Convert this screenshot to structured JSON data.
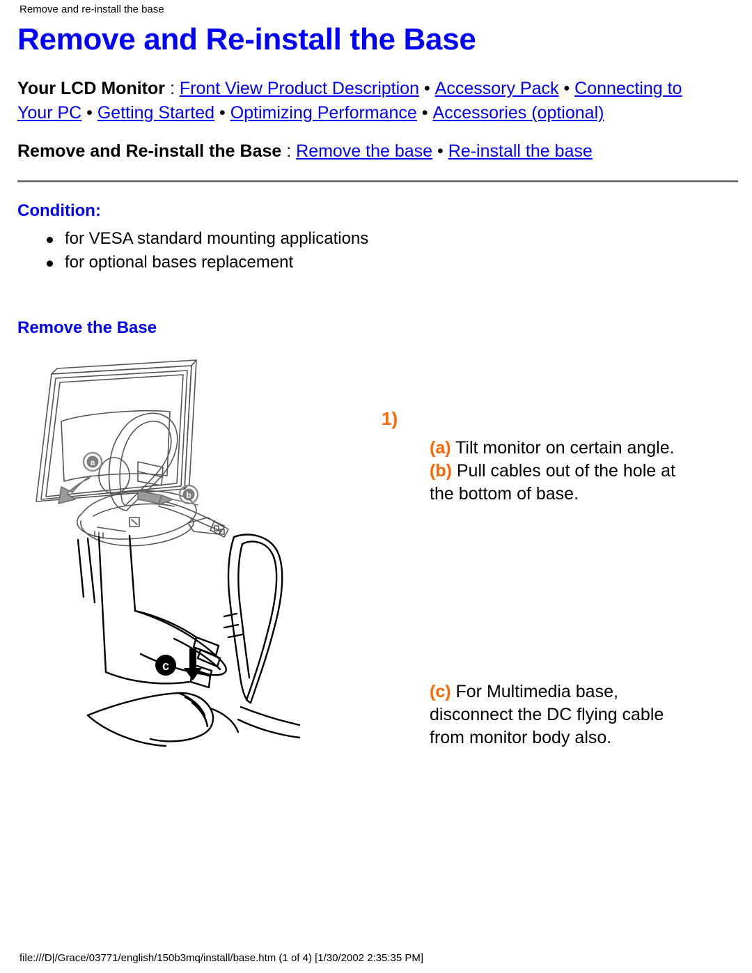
{
  "page_header": "Remove and re-install the base",
  "title": "Remove and Re-install the Base",
  "nav1": {
    "label": "Your LCD Monitor",
    "colon": " : ",
    "links": [
      "Front View Product Description",
      "Accessory Pack",
      "Connecting to Your PC",
      "Getting Started",
      "Optimizing Performance",
      "Accessories (optional)"
    ],
    "separator": "•"
  },
  "nav2": {
    "label": "Remove and Re-install the Base",
    "colon": " : ",
    "links": [
      "Remove the base",
      "Re-install the base"
    ],
    "separator": "•"
  },
  "condition": {
    "heading": "Condition:",
    "items": [
      "for VESA standard mounting applications",
      "for optional bases replacement"
    ]
  },
  "remove_section": {
    "heading": "Remove the Base",
    "step_number": "1)",
    "steps": [
      {
        "mark": "(a)",
        "text": " Tilt monitor on certain angle."
      },
      {
        "mark": "(b)",
        "text": " Pull cables out of the hole at the bottom of base."
      },
      {
        "mark": "(c)",
        "text": " For Multimedia base, disconnect the DC flying cable from monitor body also."
      }
    ],
    "callouts": [
      "a",
      "b",
      "c"
    ]
  },
  "colors": {
    "link": "#0000FF",
    "heading": "#0000FF",
    "accent": "#FF6600",
    "text": "#000000"
  },
  "footer": "file:///D|/Grace/03771/english/150b3mq/install/base.htm (1 of 4) [1/30/2002 2:35:35 PM]"
}
